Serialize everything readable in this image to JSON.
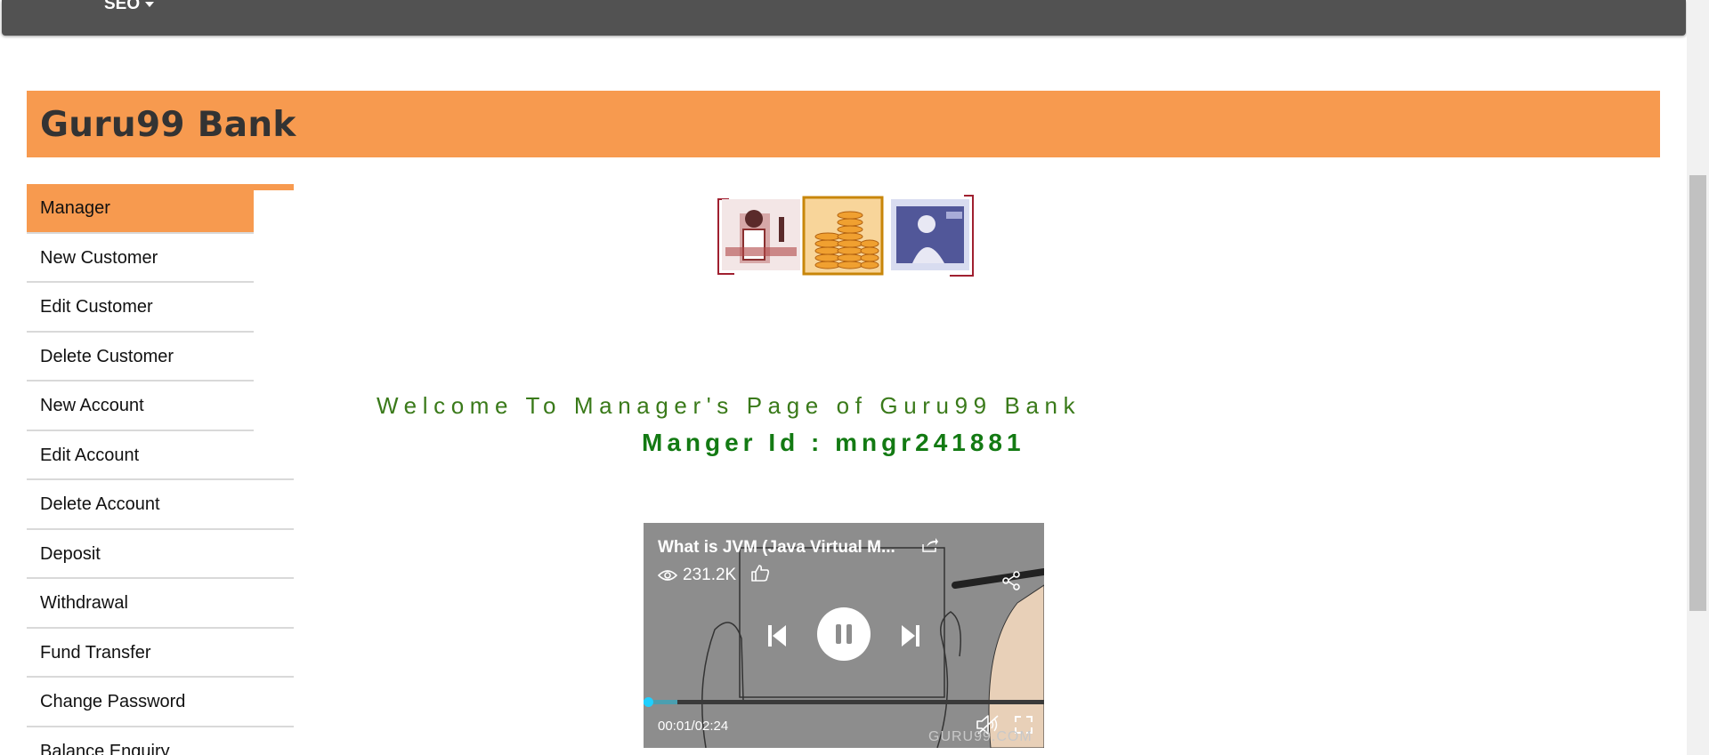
{
  "nav": {
    "menu_label": "SEO"
  },
  "banner": {
    "title": "Guru99 Bank"
  },
  "sidebar": {
    "items": [
      {
        "label": "Manager",
        "active": true
      },
      {
        "label": "New Customer"
      },
      {
        "label": "Edit Customer"
      },
      {
        "label": "Delete Customer"
      },
      {
        "label": "New Account"
      },
      {
        "label": "Edit Account"
      },
      {
        "label": "Delete Account"
      },
      {
        "label": "Deposit"
      },
      {
        "label": "Withdrawal"
      },
      {
        "label": "Fund Transfer"
      },
      {
        "label": "Change Password"
      },
      {
        "label": "Balance Enquiry"
      }
    ]
  },
  "main": {
    "welcome": "Welcome To Manager's Page of Guru99 Bank",
    "manager_id": "Manger Id : mngr241881"
  },
  "video": {
    "title": "What is JVM (Java Virtual M...",
    "views": "231.2K",
    "time": "00:01/02:24",
    "watermark": "GURU99.COM",
    "progress": 0.007
  },
  "colors": {
    "banner": "#f79a4f",
    "nav": "#525252",
    "welcome_text": "#3a7a1a",
    "manager_id_text": "#137a13",
    "progress": "#1fd0ff"
  }
}
